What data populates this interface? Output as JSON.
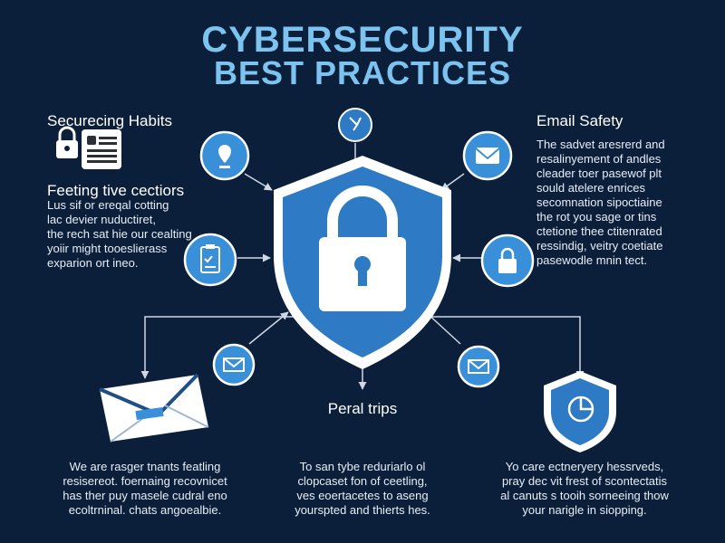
{
  "title": {
    "line1": "CYBERSECURITY",
    "line2": "BEST PRACTICES"
  },
  "left_top": {
    "heading": "Securecing Habits"
  },
  "left_mid": {
    "heading": "Feeting tive cectiors",
    "lines": [
      "Lus sif or ereqal cotting",
      "lac devier nuductiret,",
      "the rech sat hie our cealting",
      "yoiir might tooeslierass",
      "exparion ort ineo."
    ]
  },
  "right_top": {
    "heading": "Email Safety",
    "lines": [
      "The sadvet aresrerd and",
      "resalinyement of andles",
      "cleader toer pasewof plt",
      "sould atelere enrices",
      "secomnation sipoctiaine",
      "the rot you sage or tins",
      "ctetione thee ctitenrated",
      "ressindig, veitry coetiate",
      "pasewodle mnin tect."
    ]
  },
  "center_label": "Peral trips",
  "bottom_left": [
    "We are rasger tnants featling",
    "resisereot. foernaing recovnicet",
    "has ther puy masele cudral eno",
    "ecoltrninal. chats angoealbie."
  ],
  "bottom_mid": [
    "To san tybe reduriarlo ol",
    "clopcaset fon of ceetling,",
    "ves eoertacetes to aseng",
    "yourspted and thierts hes."
  ],
  "bottom_right": [
    "Yo care ectneryery hessrveds,",
    "pray dec vit frest of scontectatis",
    "al canuts s tooih sorneeing thow",
    "your narigle in siopping."
  ],
  "colors": {
    "background": "#0b1f3a",
    "accent": "#3a8fd9",
    "shield_border": "#ffffff",
    "title": "#7cc4ef"
  },
  "icons": [
    "lock-icon",
    "document-icon",
    "bug-icon",
    "location-pin-icon",
    "envelope-icon",
    "checklist-icon",
    "padlock-icon",
    "open-envelope-icon",
    "email-icon",
    "shield-icon",
    "mail-envelope-icon"
  ]
}
